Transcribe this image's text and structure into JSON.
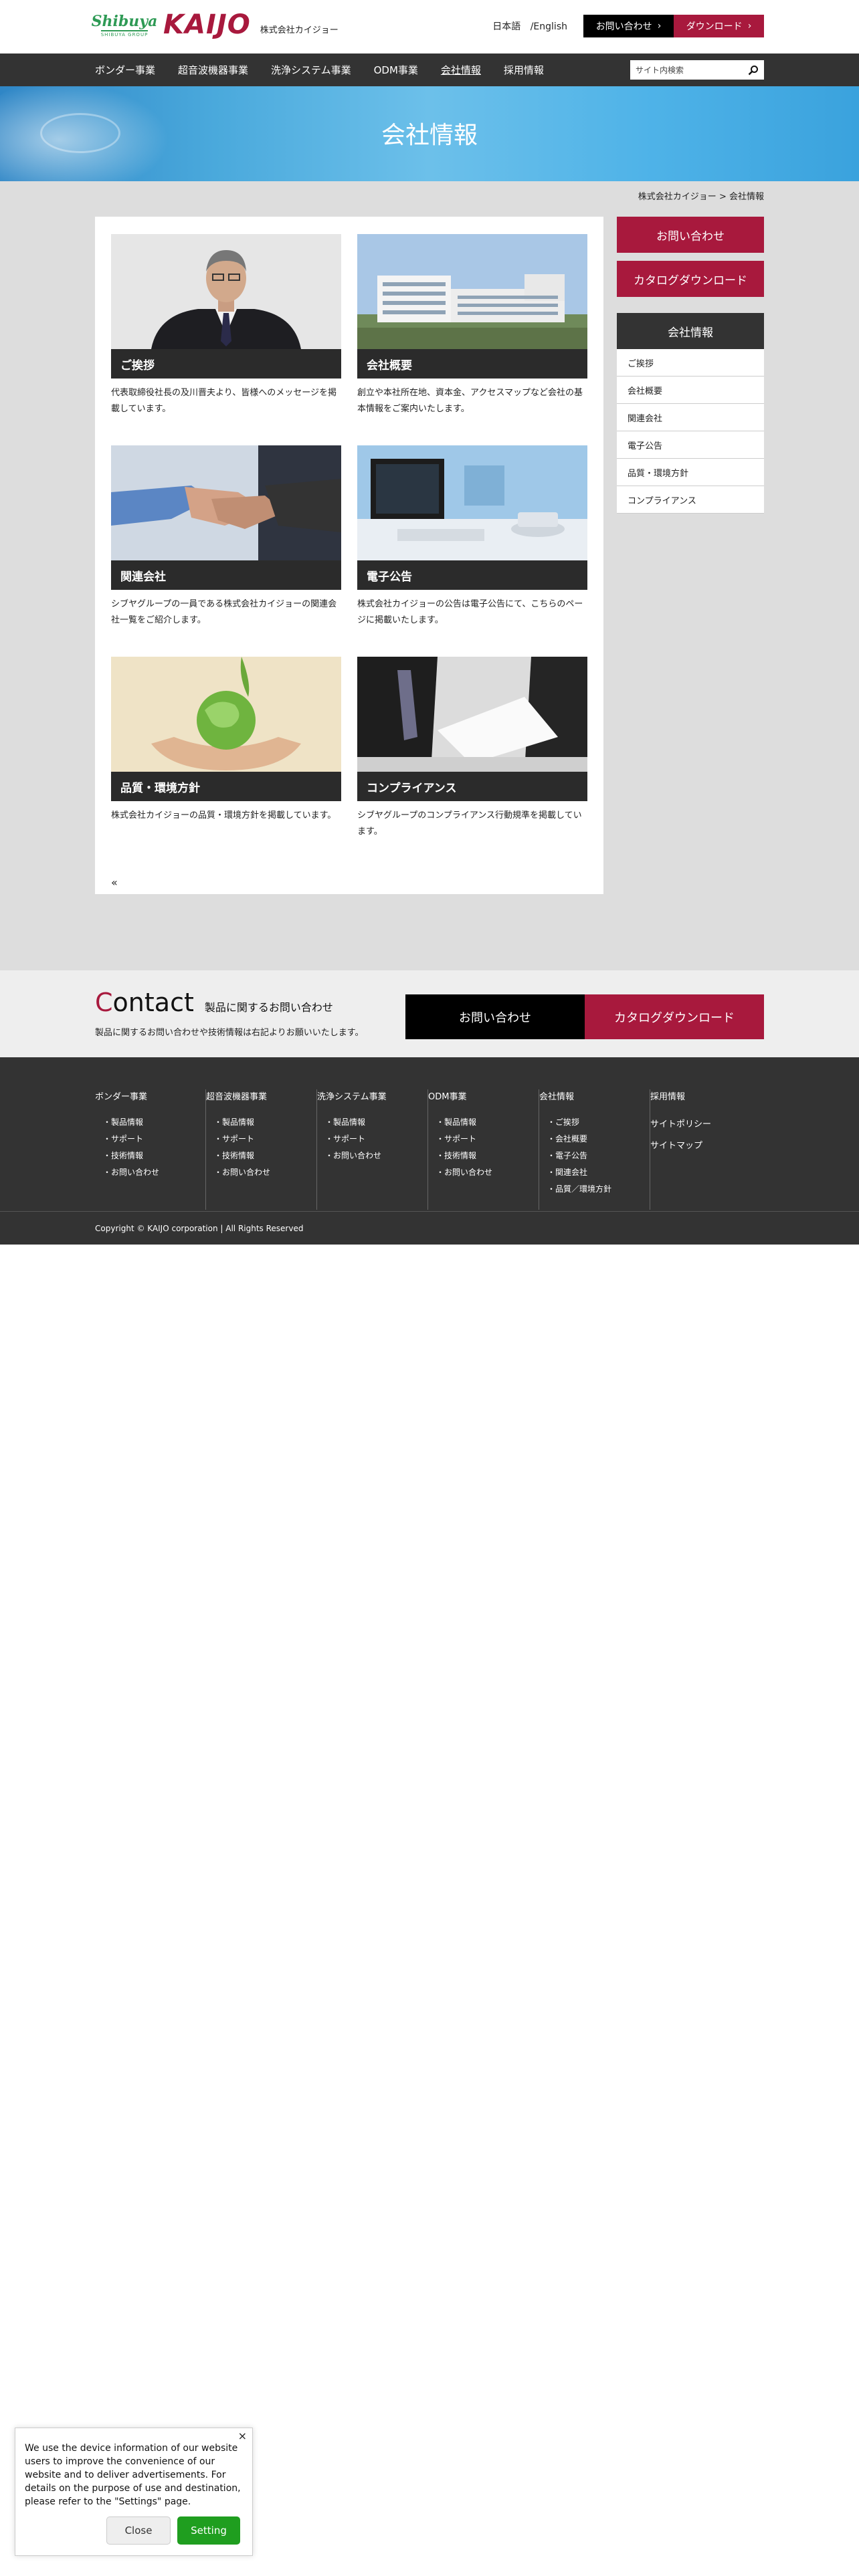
{
  "header": {
    "logo_shibuya": "Shibuya",
    "logo_shibuya_sub": "SHIBUYA GROUP",
    "logo_kaijo": "KAIJO",
    "logo_kaijo_sub": "株式会社カイジョー",
    "lang_ja": "日本語",
    "lang_en": "/English",
    "contact_label": "お問い合わせ",
    "download_label": "ダウンロード"
  },
  "nav": {
    "items": [
      "ボンダー事業",
      "超音波機器事業",
      "洗浄システム事業",
      "ODM事業",
      "会社情報",
      "採用情報"
    ],
    "search_placeholder": "サイト内検索"
  },
  "hero": {
    "title": "会社情報"
  },
  "breadcrumb": {
    "home": "株式会社カイジョー",
    "sep": ">",
    "current": "会社情報"
  },
  "cards": [
    {
      "title": "ご挨拶",
      "text": "代表取締役社長の及川晋夫より、皆様へのメッセージを掲載しています。",
      "icon": "portrait-photo"
    },
    {
      "title": "会社概要",
      "text": "創立や本社所在地、資本金、アクセスマップなど会社の基本情報をご案内いたします。",
      "icon": "building-photo"
    },
    {
      "title": "関連会社",
      "text": "シブヤグループの一員である株式会社カイジョーの関連会社一覧をご紹介します。",
      "icon": "handshake-photo"
    },
    {
      "title": "電子公告",
      "text": "株式会社カイジョーの公告は電子公告にて、こちらのページに掲載いたします。",
      "icon": "office-desk-photo"
    },
    {
      "title": "品質・環境方針",
      "text": "株式会社カイジョーの品質・環境方針を掲載しています。",
      "icon": "globe-hands-photo"
    },
    {
      "title": "コンプライアンス",
      "text": "シブヤグループのコンプライアンス行動規準を掲載しています。",
      "icon": "document-handover-photo"
    }
  ],
  "back_label": "«",
  "sidebar": {
    "contact_label": "お問い合わせ",
    "catalog_label": "カタログダウンロード",
    "heading": "会社情報",
    "items": [
      "ご挨拶",
      "会社概要",
      "関連会社",
      "電子公告",
      "品質・環境方針",
      "コンプライアンス"
    ]
  },
  "contact_band": {
    "title_first": "C",
    "title_rest": "ontact",
    "subtitle": "製品に関するお問い合わせ",
    "desc": "製品に関するお問い合わせや技術情報は右記よりお願いいたします。",
    "contact_label": "お問い合わせ",
    "catalog_label": "カタログダウンロード"
  },
  "footer": {
    "columns": [
      {
        "title": "ボンダー事業",
        "links": [
          "・製品情報",
          "・サポート",
          "・技術情報",
          "・お問い合わせ"
        ]
      },
      {
        "title": "超音波機器事業",
        "links": [
          "・製品情報",
          "・サポート",
          "・技術情報",
          "・お問い合わせ"
        ]
      },
      {
        "title": "洗浄システム事業",
        "links": [
          "・製品情報",
          "・サポート",
          "・お問い合わせ"
        ]
      },
      {
        "title": "ODM事業",
        "links": [
          "・製品情報",
          "・サポート",
          "・技術情報",
          "・お問い合わせ"
        ]
      },
      {
        "title": "会社情報",
        "links": [
          "・ご挨拶",
          "・会社概要",
          "・電子公告",
          "・関連会社",
          "・品質／環境方針"
        ]
      },
      {
        "title": "採用情報",
        "links": [
          "サイトポリシー",
          "サイトマップ"
        ]
      }
    ],
    "copyright": "Copyright © KAIJO corporation | All Rights Reserved"
  },
  "cookie": {
    "close_x": "×",
    "text": "We use the device information of our website users to improve the convenience of our website and to deliver advertisements. For details on the purpose of use and destination, please refer to the \"Settings\" page.",
    "close_label": "Close",
    "setting_label": "Setting"
  },
  "colors": {
    "brand": "#a8193d",
    "dark": "#333333",
    "hero": "#4aa9dc",
    "setting": "#1f9e1f"
  }
}
